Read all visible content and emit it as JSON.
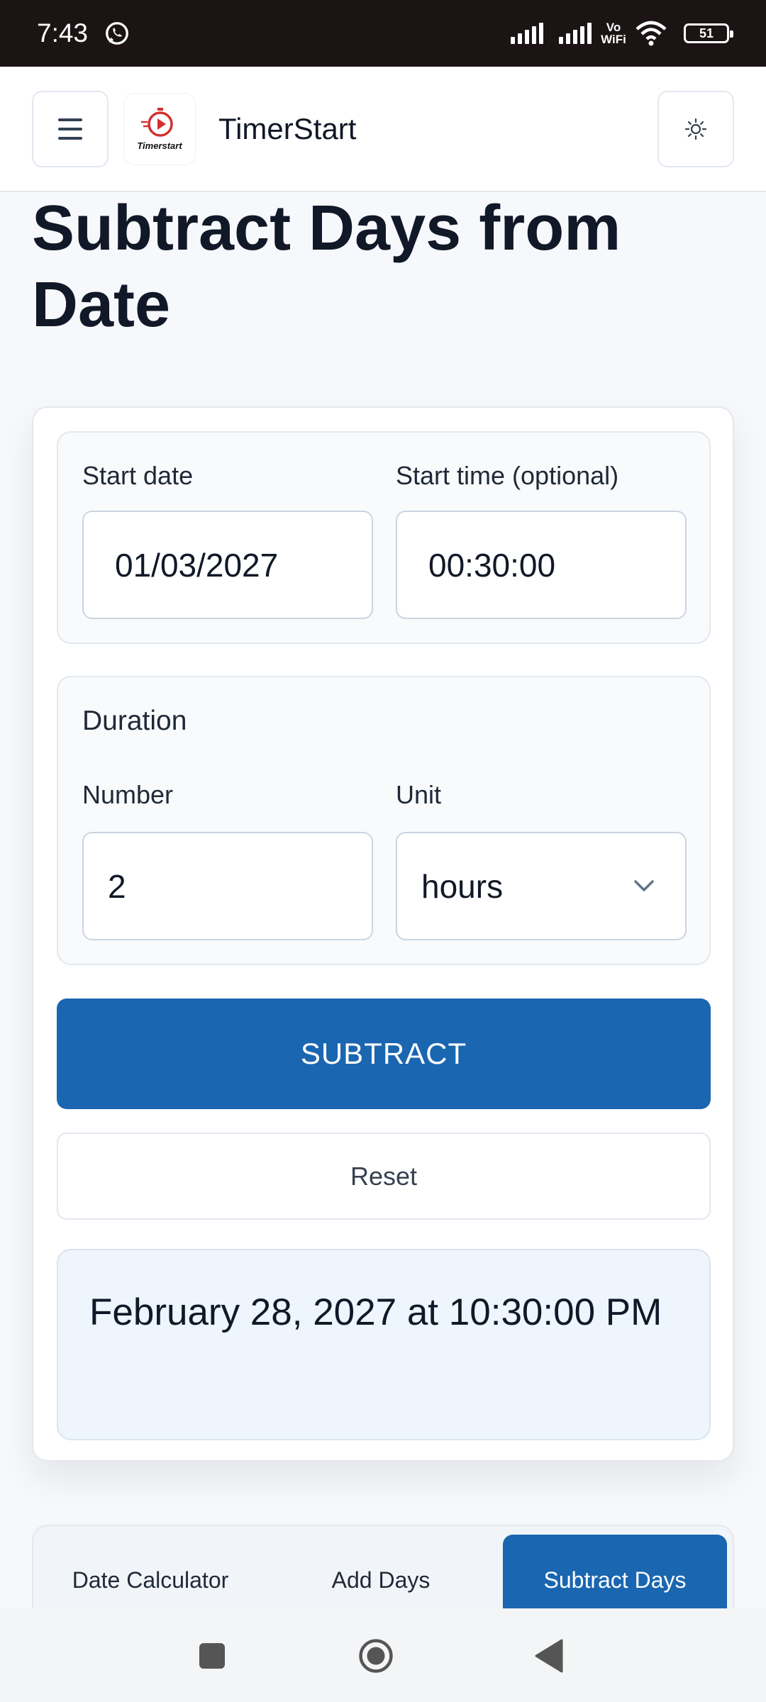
{
  "status_bar": {
    "time": "7:43",
    "battery": "51",
    "network": "Vo WiFi"
  },
  "header": {
    "title": "TimerStart",
    "logo_text": "Timerstart",
    "menu_icon": "hamburger-menu-icon",
    "theme_icon": "sun-icon"
  },
  "page": {
    "title": "Subtract Days from Date"
  },
  "form": {
    "start_date_label": "Start date",
    "start_date_value": "01/03/2027",
    "start_time_label": "Start time (optional)",
    "start_time_value": "00:30:00",
    "duration_title": "Duration",
    "number_label": "Number",
    "number_value": "2",
    "unit_label": "Unit",
    "unit_value": "hours",
    "subtract_label": "SUBTRACT",
    "reset_label": "Reset"
  },
  "result": {
    "text": "February 28, 2027 at 10:30:00 PM"
  },
  "tabs": [
    {
      "label": "Date Calculator",
      "active": false
    },
    {
      "label": "Add Days",
      "active": false
    },
    {
      "label": "Subtract Days",
      "active": true
    }
  ],
  "colors": {
    "accent": "#1a66b0",
    "result_bg": "#eef5fd",
    "logo_red": "#d32f2f"
  }
}
